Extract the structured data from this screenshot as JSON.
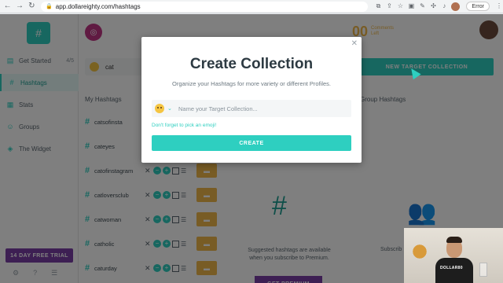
{
  "browser": {
    "url": "app.dollareighty.com/hashtags",
    "error_label": "Error"
  },
  "sidebar": {
    "items": [
      {
        "label": "Get Started",
        "count": "4/5"
      },
      {
        "label": "Hashtags"
      },
      {
        "label": "Stats"
      },
      {
        "label": "Groups"
      },
      {
        "label": "The Widget"
      }
    ],
    "trial_label": "14 DAY FREE TRIAL"
  },
  "header": {
    "comments_count": "00",
    "comments_label": "Comments",
    "comments_sub": "Left"
  },
  "search": {
    "value": "cat"
  },
  "new_target_label": "NEW TARGET COLLECTION",
  "columns": {
    "my_hashtags": "My Hashtags",
    "group_hashtags": "Group Hashtags"
  },
  "hashtags": [
    "catsofinsta",
    "cateyes",
    "catofinstagram",
    "catloversclub",
    "catwoman",
    "catholic",
    "caturday"
  ],
  "premium": {
    "suggested_text": "Suggested hashtags are available when you subscribe to Premium.",
    "get_premium_label": "GET PREMIUM",
    "subscribe_text": "Subscrib"
  },
  "modal": {
    "title": "Create Collection",
    "subtitle": "Organize your Hashtags for more variety or different Profiles.",
    "input_placeholder": "Name your Target Collection...",
    "emoji_reminder": "Don't forget to pick an emoji!",
    "create_label": "CREATE"
  },
  "webcam": {
    "shirt_text": "DOLLAR80"
  },
  "colors": {
    "accent": "#2ecfc0",
    "premium": "#7b3fa6",
    "comments": "#f0b84b"
  }
}
